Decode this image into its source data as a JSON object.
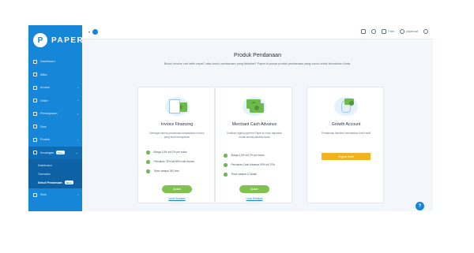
{
  "brand": {
    "name": "PAPER",
    "logo_letter": "P"
  },
  "sidebar": {
    "items": [
      {
        "label": "Dashboard",
        "chevron": false
      },
      {
        "label": "Mitra",
        "chevron": false
      },
      {
        "label": "Invoice",
        "chevron": true
      },
      {
        "label": "Order",
        "chevron": true
      },
      {
        "label": "Pembayaran",
        "chevron": true
      },
      {
        "label": "Stok",
        "chevron": false
      },
      {
        "label": "Produk",
        "chevron": true
      },
      {
        "label": "Keuangan",
        "badge": "Baru",
        "chevron": true,
        "active": true
      }
    ],
    "submenu": [
      {
        "label": "Dashboard"
      },
      {
        "label": "Transaksi"
      },
      {
        "label": "Sekuil Pendanaan",
        "badge": "Baru",
        "current": true
      }
    ],
    "last_item": {
      "label": "Stok",
      "chevron": true
    }
  },
  "topbar": {
    "left_label": "▾",
    "help_label": "?",
    "user_label": "Free",
    "account_label": "papercat"
  },
  "page": {
    "title": "Produk Pendanaan",
    "subtitle": "Butuh Invoice cair lebih cepat? atau butuh pendanaan yang fleksibel? Paper.id punya produk pendanaan yang cocok untuk kebutuhan Anda."
  },
  "cards": [
    {
      "title": "Invoice Financing",
      "desc": "Berbagai skema pendanaan berbasiskan Invoice yang telah terbayarkan",
      "features": [
        "Bunga 1,5% s/d 2% per bulan",
        "Pencairan 75% s/d 80% nilai Invoice",
        "Tenor sampai 180 Hari"
      ],
      "apply": "Ajukan",
      "simulate": "Lihat Simulasi"
    },
    {
      "title": "Merchant Cash Advance",
      "desc": "Suntikan digital payment Paper.id untuk dapatkan modal sesuai aktivitas Anda",
      "features": [
        "Bunga 1,5% s/d 2% per bulan",
        "Pencairan Cash Advance 50% s/d 70%",
        "Tenor sampai 12 Bulan"
      ],
      "apply": "Ajukan",
      "simulate": "Lihat Simulasi"
    },
    {
      "title": "Growth Account",
      "desc": "Pendanaan fleksibel berbasiskan limit kredit",
      "ribbon": "Segera Hadir"
    }
  ],
  "help_button": "?"
}
